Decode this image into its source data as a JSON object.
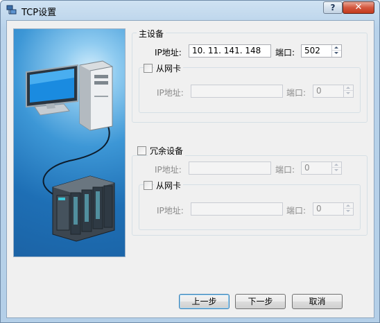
{
  "window": {
    "title": "TCP设置",
    "help_label": "?",
    "close_label": "✕"
  },
  "main_device": {
    "group_label": "主设备",
    "ip_label": "IP地址:",
    "ip_value": "10. 11. 141. 148",
    "port_label": "端口:",
    "port_value": "502",
    "slave_nic": {
      "checkbox_label": "从网卡",
      "checked": false,
      "ip_label": "IP地址:",
      "ip_value": "",
      "port_label": "端口:",
      "port_value": "0"
    }
  },
  "redundant_device": {
    "checkbox_label": "冗余设备",
    "checked": false,
    "ip_label": "IP地址:",
    "ip_value": "",
    "port_label": "端口:",
    "port_value": "0",
    "slave_nic": {
      "checkbox_label": "从网卡",
      "checked": false,
      "ip_label": "IP地址:",
      "ip_value": "",
      "port_label": "端口:",
      "port_value": "0"
    }
  },
  "buttons": {
    "prev": "上一步",
    "next": "下一步",
    "cancel": "取消"
  },
  "colors": {
    "title_bar": "#b8d2ea",
    "client_bg": "#f0f0f0",
    "picture_bg": "#1e6fb5"
  }
}
